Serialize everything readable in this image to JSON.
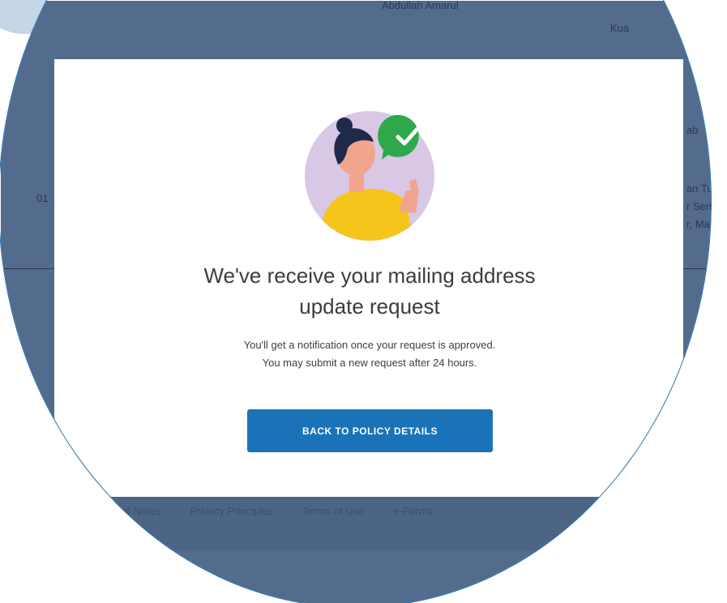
{
  "background": {
    "header_name": "Abdullah Amarul",
    "header_city": "Kua",
    "row_id": "01",
    "right_label": "ab",
    "right_address_lines": [
      "an Tun",
      "r Sent",
      "r, Male"
    ]
  },
  "footer": {
    "links": [
      "Legal Notes",
      "Privacy Principles",
      "Terms of Use",
      "e-Forms"
    ]
  },
  "modal": {
    "illustration": "woman-thumbs-up-with-checkmark",
    "title_line1": "We've receive your mailing address",
    "title_line2": "update request",
    "subtext_line1": "You'll get a notification once your request is approved.",
    "subtext_line2": "You may submit a new request after 24 hours.",
    "cta_label": "BACK TO POLICY DETAILS"
  },
  "colors": {
    "overlay": "#536b8c",
    "button": "#1a73b8",
    "check_badge": "#2ea84a",
    "illustration_bg": "#d9c7e6"
  }
}
